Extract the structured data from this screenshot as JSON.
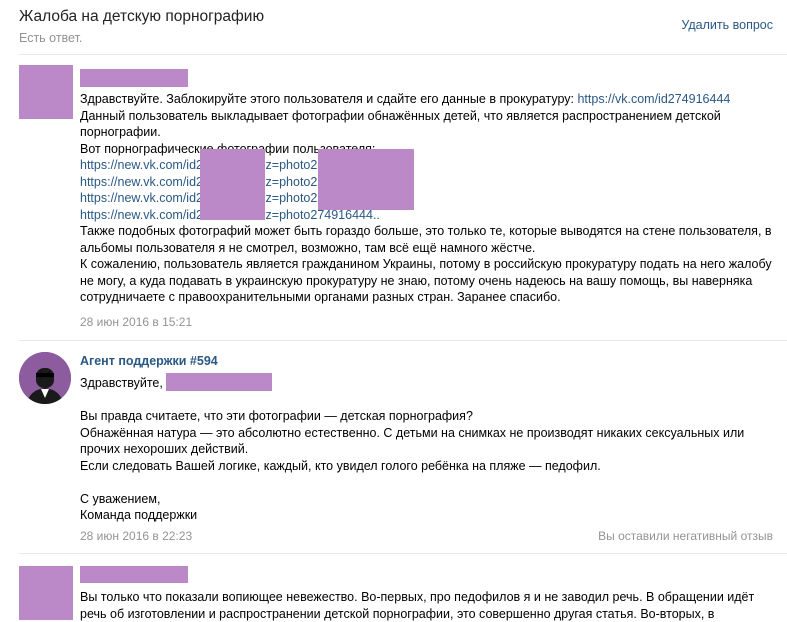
{
  "header": {
    "title": "Жалоба на детскую порнографию",
    "status": "Есть ответ.",
    "delete_label": "Удалить вопрос"
  },
  "message1": {
    "greeting_text": "Здравствуйте. Заблокируйте этого пользователя и сдайте его данные в прокуратуру: ",
    "profile_link": "https://vk.com/id274916444",
    "paragraph2": "Данный пользователь выкладывает фотографии обнажённых детей, что является распространением детской порнографии.",
    "paragraph3": "Вот порнографические фотографии пользователя:",
    "photo_links": [
      "https://new.vk.com/id274916444?z=photo274916444..",
      "https://new.vk.com/id274916444?z=photo274916444..",
      "https://new.vk.com/id274916444?z=photo274916444..",
      "https://new.vk.com/id274916444?z=photo274916444.."
    ],
    "paragraph4": "Также подобных фотографий может быть гораздо больше, это только те, которые выводятся на стене пользователя, в альбомы пользователя я не смотрел, возможно, там всё ещё намного жёстче.",
    "paragraph5": "К сожалению, пользователь является гражданином Украины, потому в российскую прокуратуру подать на него жалобу не могу, а куда подавать в украинскую прокуратуру не знаю, потому очень надеюсь на вашу помощь, вы наверняка сотрудничаете с правоохранительными органами разных стран. Заранее спасибо.",
    "date": "28 июн 2016 в 15:21"
  },
  "message2": {
    "author": "Агент поддержки #594",
    "greeting": "Здравствуйте,",
    "line1": "Вы правда считаете, что эти фотографии — детская порнография?",
    "line2": "Обнажённая натура — это абсолютно естественно. С детьми на снимках не производят никаких сексуальных или прочих нехороших действий.",
    "line3": "Если следовать Вашей логике, каждый, кто увидел голого ребёнка на пляже — педофил.",
    "sign1": "С уважением,",
    "sign2": "Команда поддержки",
    "date": "28 июн 2016 в 22:23",
    "feedback_note": "Вы оставили негативный отзыв"
  },
  "message3": {
    "text": "Вы только что показали вопиющее невежество. Во-первых, про педофилов я и не заводил речь. В обращении идёт речь об изготовлении и распространении детской порнографии, это совершенно другая статья. Во-вторых, в"
  }
}
